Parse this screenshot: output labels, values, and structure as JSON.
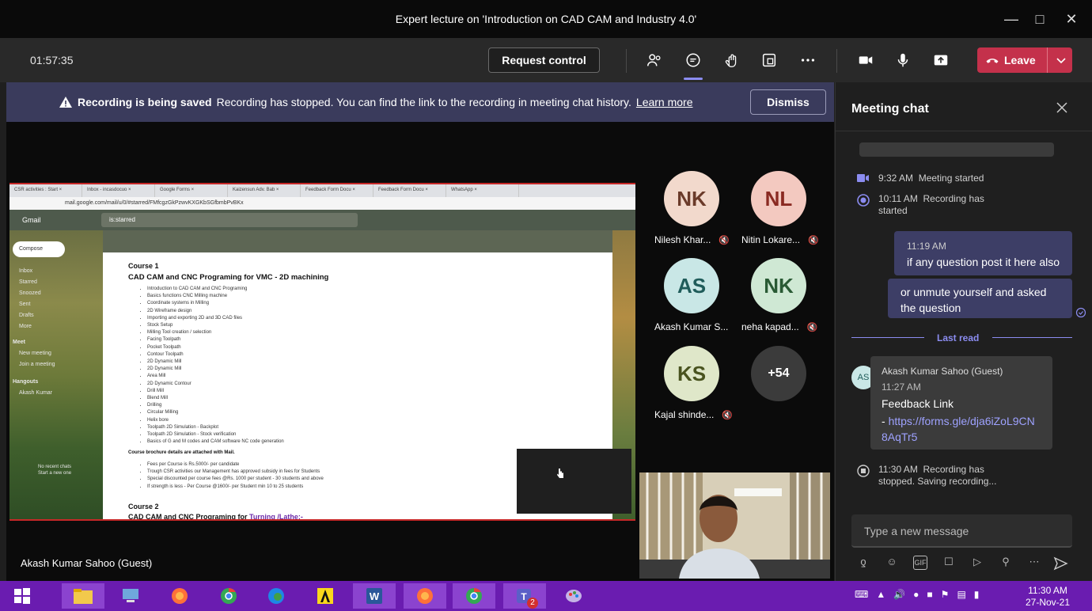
{
  "window": {
    "title": "Expert lecture on 'Introduction on CAD CAM and Industry 4.0'"
  },
  "toolbar": {
    "timer": "01:57:35",
    "request_control": "Request control",
    "leave": "Leave"
  },
  "banner": {
    "bold": "Recording is being saved",
    "message": "Recording has stopped. You can find the link to the recording in meeting chat history.",
    "link": "Learn more",
    "dismiss": "Dismiss"
  },
  "share": {
    "tabs": [
      "CSR activities : Start ×",
      "Inbox - incasdocuo ×",
      "Google Forms ×",
      "Kaizensun Adv. Bab ×",
      "Feedback Form Docu ×",
      "Feedback Form Docu ×",
      "WhatsApp ×"
    ],
    "url": "mail.google.com/mail/u/0/#starred/FMfcgzGkPzwvKXGKbSGfbmbPvBKx",
    "gmail": "Gmail",
    "search": "is:starred",
    "compose": "Compose",
    "nav": [
      "Inbox",
      "Starred",
      "Snoozed",
      "Sent",
      "Drafts",
      "More"
    ],
    "meet_title": "Meet",
    "meet": [
      "New meeting",
      "Join a meeting"
    ],
    "hangouts": "Hangouts",
    "hangouts_user": "Akash Kumar",
    "no_chats": "No recent chats",
    "start_new": "Start a new one",
    "course1": "Course 1",
    "course1_title": "CAD CAM and CNC Programing for VMC - 2D machining",
    "course1_items": [
      "Introduction to CAD CAM and CNC Programing",
      "Basics functions CNC Milling machine",
      "Coordinate systems in Milling",
      "2D Wireframe design",
      "Importing and exporting 2D and 3D CAD files",
      "Stock Setup",
      "Milling Tool creation / selection",
      "Facing Toolpath",
      "Pocket Toolpath",
      "Contour Toolpath",
      "2D Dynamic Mill",
      "2D Dynamic Mill",
      "Area Mill",
      "2D Dynamic Contour",
      "Drill Mill",
      "Blend Mill",
      "Drilling",
      "Circular Milling",
      "Helix bore",
      "Toolpath 2D Simulation - Backplot",
      "Toolpath 2D Simulation - Stock verification",
      "Basics of G and M codes and CAM software NC code generation"
    ],
    "brochure": "Course brochure details are attached with Mail.",
    "fees": [
      "Fees per Course is Rs.5000/- per candidate",
      "Trough CSR activities our Management has approved subsidy in fees for Students",
      "Special discounted per course fees @Rs. 1000 per student - 30 students and above",
      "If strength is less - Per Course @1600/- per Student min 10 to 25 students"
    ],
    "course2": "Course 2",
    "course2_title_a": "CAD CAM and CNC Programing for ",
    "course2_title_b": "Turning /Lathe:-"
  },
  "presenter": "Akash Kumar Sahoo (Guest)",
  "participants": [
    {
      "initials": "NK",
      "name": "Nilesh Khar..."
    },
    {
      "initials": "NL",
      "name": "Nitin Lokare..."
    },
    {
      "initials": "AS",
      "name": "Akash Kumar S..."
    },
    {
      "initials": "NK",
      "name": "neha kapad..."
    },
    {
      "initials": "KS",
      "name": "Kajal shinde..."
    },
    {
      "initials": "+54",
      "name": ""
    }
  ],
  "chat": {
    "title": "Meeting chat",
    "events": [
      {
        "time": "9:32 AM",
        "text": "Meeting started"
      },
      {
        "time": "10:11 AM",
        "text": "Recording has started"
      }
    ],
    "my_time": "11:19 AM",
    "my_msg1": "if any question post it here also",
    "my_msg2": "or unmute yourself and asked the question",
    "last_read": "Last read",
    "sender": "Akash Kumar Sahoo (Guest)",
    "sender_initials": "AS",
    "sender_time": "11:27 AM",
    "sender_msg": "Feedback Link",
    "sender_link_prefix": "- ",
    "sender_link": "https://forms.gle/dja6iZoL9CN8AqTr5",
    "stop_time": "11:30 AM",
    "stop_text": "Recording has stopped. Saving recording...",
    "placeholder": "Type a new message"
  },
  "taskbar": {
    "time": "11:30 AM",
    "date": "27-Nov-21",
    "teams_badge": "2"
  },
  "colors": {
    "accent": "#8b8cf0",
    "leave": "#c4314b",
    "banner": "#3a3b5c",
    "taskbar": "#6a1cb0"
  }
}
